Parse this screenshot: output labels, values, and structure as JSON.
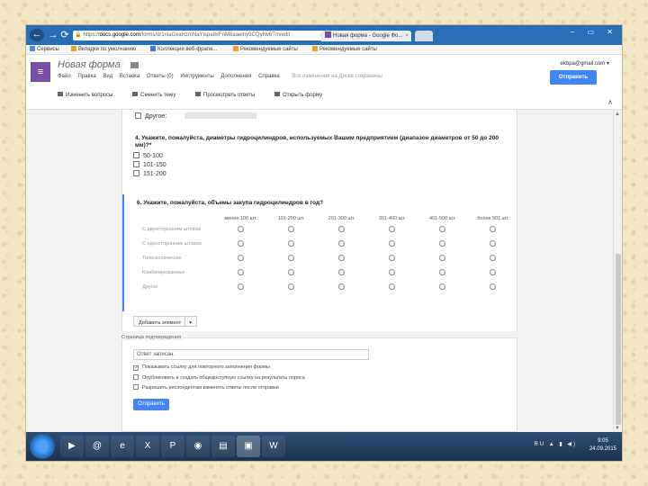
{
  "browser": {
    "url_scheme": "https://",
    "url_domain": "docs.google.com",
    "url_rest": "/forms/d/1nlaGxaHzmNaYlspa8xFnM8aaemy9CQyNv6Tm/edit",
    "tab_title": "Новая форма - Google Фо...",
    "tab_close": "×",
    "tab_new": "",
    "window_controls": "– ▭ ✕"
  },
  "bookmarks": [
    {
      "label": "Сервисы",
      "color": "#4a90d9"
    },
    {
      "label": "Вкладки по умолчанию",
      "color": "#e8a33d"
    },
    {
      "label": "Коллекция веб-фрагм...",
      "color": "#3b7dd8"
    },
    {
      "label": "Рекомендуемые сайты",
      "color": "#f0a030"
    },
    {
      "label": "Рекомендуемые сайты",
      "color": "#f0a030"
    }
  ],
  "header": {
    "app_icon": "≡",
    "form_title": "Новая форма",
    "star": "☆",
    "menu": [
      "Файл",
      "Правка",
      "Вид",
      "Вставка",
      "Ответы (0)",
      "Инструменты",
      "Дополнения",
      "Справка"
    ],
    "saved_status": "Все изменения на Диске сохранены",
    "user_email": "ekbpa@gmail.com ▾",
    "send_label": "Отправить",
    "toolbar": [
      "Изменить вопросы",
      "Сменить тему",
      "Просмотреть ответы",
      "Открыть форму"
    ],
    "chevron": "∧"
  },
  "form": {
    "other_label": "Другое:",
    "q4_title": "4. Укажите, пожалуйста, диаметры гидроцилиндров, используемых Вашим предприятием (диапазон диаметров от 50 до 200 мм)?*",
    "q4_options": [
      "50-100",
      "101-150",
      "151-200"
    ],
    "q6_title": "6. Укажите, пожалуйста, объемы закупа гидроцилиндров в год?",
    "q6_columns": [
      "менее 100 шт.",
      "101-200 шт.",
      "201-300 шт.",
      "301-400 шт.",
      "401-500 шт.",
      "более 501 шт."
    ],
    "q6_rows": [
      "С двухсторонним штоком",
      "С односторонним штоком",
      "Телескопические",
      "Комбинированные",
      "Другое"
    ],
    "add_element": "Добавить элемент",
    "add_element_caret": "▾"
  },
  "confirmation": {
    "label": "Страница подтверждения",
    "input_value": "Ответ записан.",
    "options": [
      {
        "label": "Показывать ссылку для повторного заполнения формы",
        "checked": true
      },
      {
        "label": "Опубликовать и создать общедоступную ссылку на результаты опроса",
        "checked": false
      },
      {
        "label": "Разрешить респондентам изменять ответы после отправки",
        "checked": false
      }
    ],
    "send_label": "Отправить"
  },
  "taskbar": {
    "apps": [
      "▶",
      "@",
      "e",
      "X",
      "P",
      "◉",
      "▤",
      "▣",
      "W"
    ],
    "tray": "RU ▲ ▮ ◀)",
    "time": "9:05",
    "date": "24.09.2015"
  }
}
